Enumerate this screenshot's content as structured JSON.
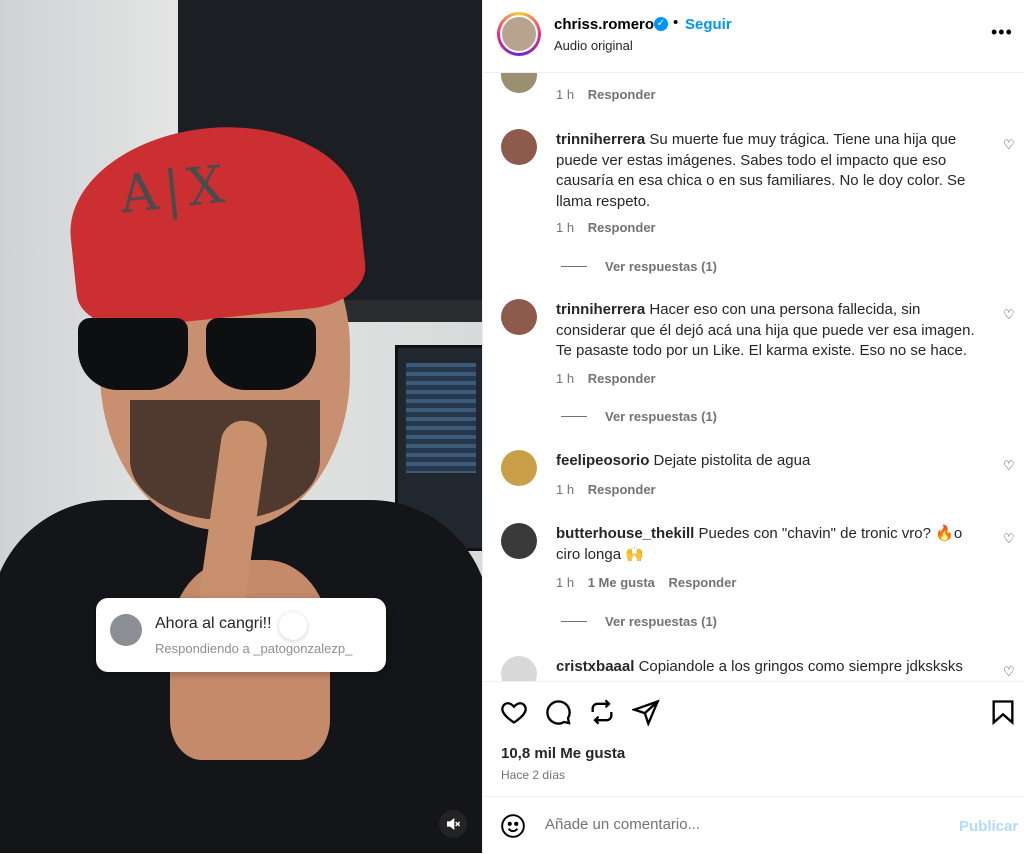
{
  "reply_card": {
    "text": "Ahora al cangri!!",
    "sub": "Respondiendo a _patogonzalezp_"
  },
  "header": {
    "username": "chriss.romero",
    "verified_mark": "✓",
    "dot": "•",
    "follow_label": "Seguir",
    "subtitle": "Audio original",
    "more": "•••"
  },
  "comments": [
    {
      "username": "",
      "text": "",
      "time": "1 h",
      "likes": "",
      "reply": "Responder",
      "view_replies": ""
    },
    {
      "username": "trinniherrera",
      "text": "Su muerte fue muy trágica. Tiene una hija que puede ver estas imágenes. Sabes todo el impacto que eso causaría en esa chica o en sus familiares. No le doy color. Se llama respeto.",
      "time": "1 h",
      "likes": "",
      "reply": "Responder",
      "view_replies": "Ver respuestas (1)"
    },
    {
      "username": "trinniherrera",
      "text": "Hacer eso con una persona fallecida, sin considerar que él dejó acá una hija que puede ver esa imagen. Te pasaste todo por un Like. El karma existe. Eso no se hace.",
      "time": "1 h",
      "likes": "",
      "reply": "Responder",
      "view_replies": "Ver respuestas (1)"
    },
    {
      "username": "feelipeosorio",
      "text": "Dejate pistolita de agua",
      "time": "1 h",
      "likes": "",
      "reply": "Responder",
      "view_replies": ""
    },
    {
      "username": "butterhouse_thekill",
      "text": "Puedes con \"chavin\" de tronic vro? 🔥o ciro longa 🙌",
      "time": "1 h",
      "likes": "1 Me gusta",
      "reply": "Responder",
      "view_replies": "Ver respuestas (1)"
    },
    {
      "username": "cristxbaaal",
      "text": "Copiandole a los gringos como siempre jdksksks",
      "time": "",
      "likes": "",
      "reply": "",
      "view_replies": ""
    }
  ],
  "actions": {
    "likes": "10,8 mil Me gusta",
    "when": "Hace 2 días"
  },
  "add_comment": {
    "placeholder": "Añade un comentario...",
    "publish_label": "Publicar"
  },
  "colors": {
    "accent": "#0095f6",
    "publish_disabled": "#b3dbff",
    "muted_text": "#737373"
  },
  "icons": [
    "heart-icon",
    "comment-icon",
    "repost-icon",
    "share-icon",
    "bookmark-icon",
    "emoji-icon",
    "muted-icon",
    "verified-icon",
    "more-icon"
  ]
}
